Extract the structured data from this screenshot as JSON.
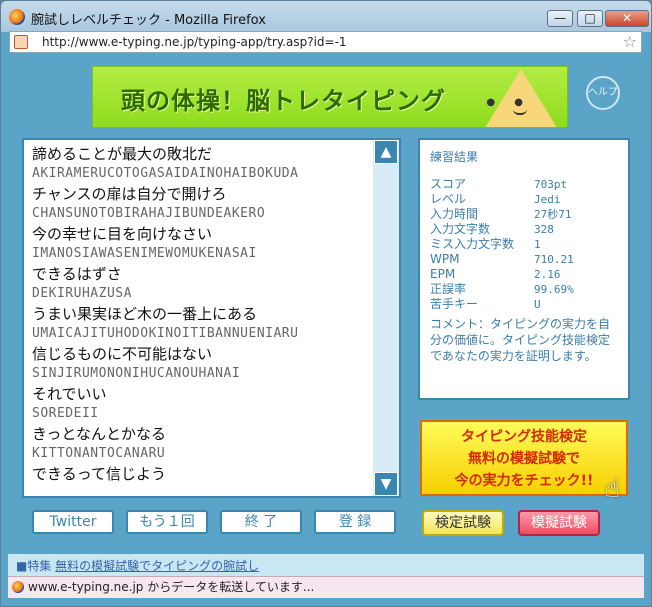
{
  "window": {
    "title": "腕試しレベルチェック - Mozilla Firefox",
    "min_label": "—",
    "max_label": "□",
    "close_label": "✕",
    "url": "http://www.e-typing.ne.jp/typing-app/try.asp?id=-1"
  },
  "banner": {
    "title": "頭の体操！脳トレタイピング",
    "help_label": "ヘルプ"
  },
  "list": {
    "items": [
      {
        "jp": "諦めることが最大の敗北だ",
        "ro": "AKIRAMERUCOTOGASAIDAINOHAIBOKUDA"
      },
      {
        "jp": "チャンスの扉は自分で開けろ",
        "ro": "CHANSUNOTOBIRAHAJIBUNDEAKERO"
      },
      {
        "jp": "今の幸せに目を向けなさい",
        "ro": "IMANOSIAWASENIMEWOMUKENASAI"
      },
      {
        "jp": "できるはずさ",
        "ro": "DEKIRUHAZUSA"
      },
      {
        "jp": "うまい果実ほど木の一番上にある",
        "ro": "UMAICAJITUHODOKINOITIBANNUENIARU"
      },
      {
        "jp": "信じるものに不可能はない",
        "ro": "SINJIRUMONONIHUCANOUHANAI"
      },
      {
        "jp": "それでいい",
        "ro": "SOREDEII"
      },
      {
        "jp": "きっとなんとかなる",
        "ro": "KITTONANTOCANARU"
      },
      {
        "jp": "できるって信じよう",
        "ro": ""
      }
    ],
    "scroll_up": "▲",
    "scroll_down": "▼"
  },
  "result": {
    "title": "練習結果",
    "rows": [
      {
        "label": "スコア",
        "value": "703pt"
      },
      {
        "label": "レベル",
        "value": "Jedi"
      },
      {
        "label": "入力時間",
        "value": "27秒71"
      },
      {
        "label": "入力文字数",
        "value": "328"
      },
      {
        "label": "ミス入力文字数",
        "value": "1"
      },
      {
        "label": "WPM",
        "value": "710.21"
      },
      {
        "label": "EPM",
        "value": "2.16"
      },
      {
        "label": "正誤率",
        "value": "99.69%"
      },
      {
        "label": "苦手キー",
        "value": "U"
      }
    ],
    "comment": "コメント：タイピングの実力を自分の価値に。タイピング技能検定であなたの実力を証明します。"
  },
  "promo": {
    "line1": "タイピング技能検定",
    "line2": "無料の模擬試験で",
    "line3": "今の実力をチェック!!"
  },
  "buttons": {
    "twitter": "Twitter",
    "retry": "もう１回",
    "end": "終 了",
    "register": "登 録",
    "kentei": "検定試験",
    "mogi": "模擬試験"
  },
  "footer": {
    "prefix": "■特集",
    "link": "無料の模擬試験でタイピングの腕試し"
  },
  "status": {
    "text": "www.e-typing.ne.jp からデータを転送しています..."
  }
}
